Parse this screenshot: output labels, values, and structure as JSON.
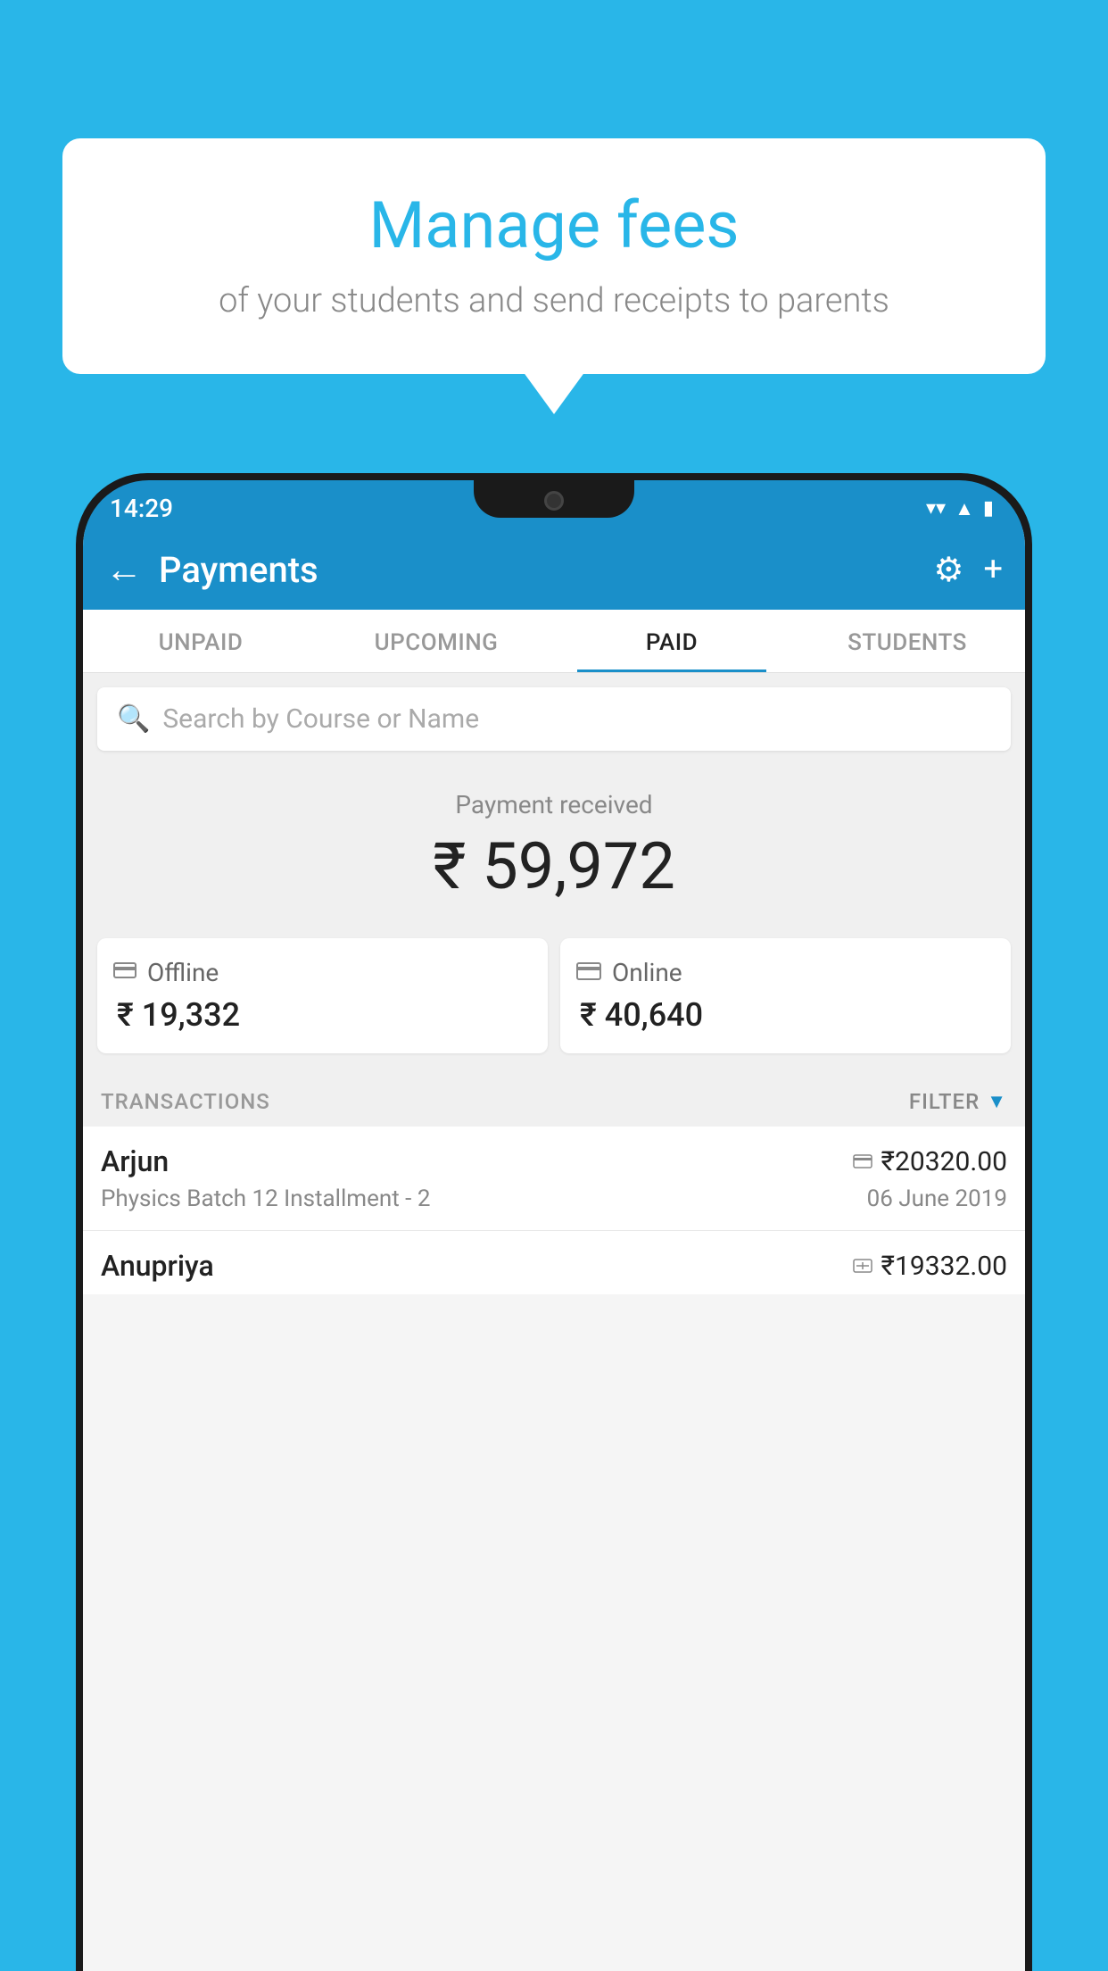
{
  "page": {
    "background_color": "#29b6e8"
  },
  "speech_bubble": {
    "title": "Manage fees",
    "subtitle": "of your students and send receipts to parents"
  },
  "status_bar": {
    "time": "14:29",
    "wifi_icon": "▼",
    "signal_icon": "▲",
    "battery_icon": "▮"
  },
  "app_bar": {
    "title": "Payments",
    "back_label": "←",
    "gear_label": "⚙",
    "plus_label": "+"
  },
  "tabs": [
    {
      "id": "unpaid",
      "label": "UNPAID",
      "active": false
    },
    {
      "id": "upcoming",
      "label": "UPCOMING",
      "active": false
    },
    {
      "id": "paid",
      "label": "PAID",
      "active": true
    },
    {
      "id": "students",
      "label": "STUDENTS",
      "active": false
    }
  ],
  "search": {
    "placeholder": "Search by Course or Name"
  },
  "payment_summary": {
    "label": "Payment received",
    "amount": "₹ 59,972"
  },
  "payment_cards": [
    {
      "id": "offline",
      "icon": "💳",
      "type": "Offline",
      "amount": "₹ 19,332"
    },
    {
      "id": "online",
      "icon": "💳",
      "type": "Online",
      "amount": "₹ 40,640"
    }
  ],
  "transactions": {
    "label": "TRANSACTIONS",
    "filter_label": "FILTER",
    "items": [
      {
        "name": "Arjun",
        "course": "Physics Batch 12 Installment - 2",
        "amount": "₹20320.00",
        "date": "06 June 2019",
        "payment_type": "online"
      },
      {
        "name": "Anupriya",
        "course": "",
        "amount": "₹19332.00",
        "date": "",
        "payment_type": "offline"
      }
    ]
  }
}
